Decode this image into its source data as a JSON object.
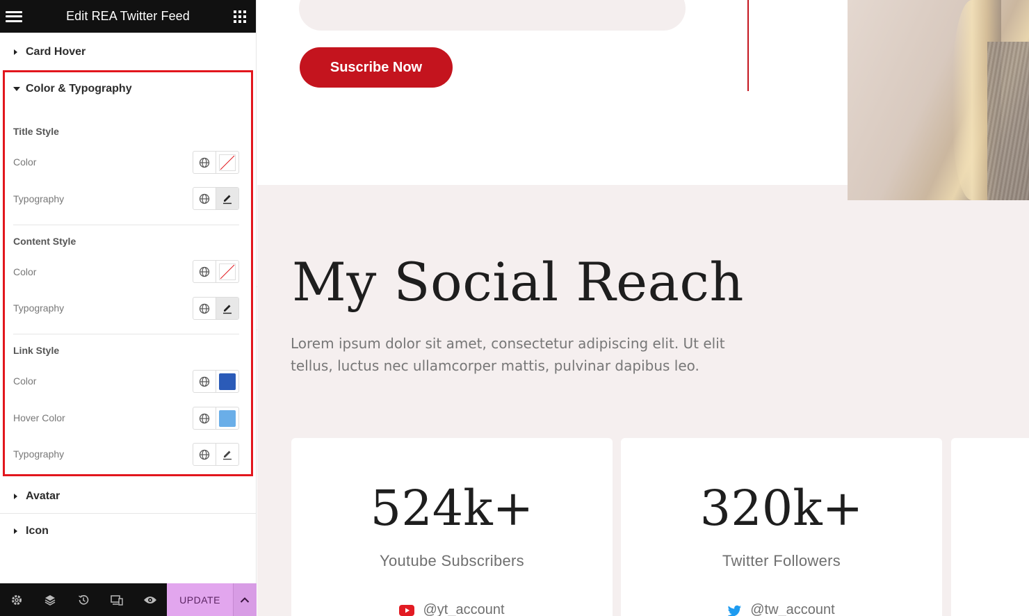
{
  "panel": {
    "title": "Edit REA Twitter Feed",
    "sections": {
      "card_hover": "Card Hover",
      "color_typography": "Color & Typography",
      "avatar": "Avatar",
      "icon": "Icon"
    },
    "title_style": {
      "heading": "Title Style",
      "color_label": "Color",
      "typography_label": "Typography"
    },
    "content_style": {
      "heading": "Content Style",
      "color_label": "Color",
      "typography_label": "Typography"
    },
    "link_style": {
      "heading": "Link Style",
      "color_label": "Color",
      "color_value": "#2b5bb8",
      "hover_color_label": "Hover Color",
      "hover_color_value": "#6aaee8",
      "typography_label": "Typography"
    },
    "footer": {
      "update_label": "UPDATE",
      "icons": [
        "gear-icon",
        "layers-icon",
        "history-icon",
        "responsive-icon",
        "eye-icon"
      ]
    }
  },
  "canvas": {
    "subscribe_label": "Suscribe Now",
    "reach": {
      "title": "My Social Reach",
      "description": "Lorem ipsum dolor sit amet, consectetur adipiscing elit. Ut elit tellus, luctus nec ullamcorper mattis, pulvinar dapibus leo."
    },
    "stats": [
      {
        "number": "524k+",
        "label": "Youtube Subscribers",
        "account": "@yt_account",
        "icon": "youtube-icon",
        "icon_color": "#e21b23"
      },
      {
        "number": "320k+",
        "label": "Twitter Followers",
        "account": "@tw_account",
        "icon": "twitter-icon",
        "icon_color": "#1d9bf0"
      }
    ]
  },
  "colors": {
    "highlight": "#e2161d",
    "accent": "#c4141e",
    "update": "#e2a6ee"
  }
}
